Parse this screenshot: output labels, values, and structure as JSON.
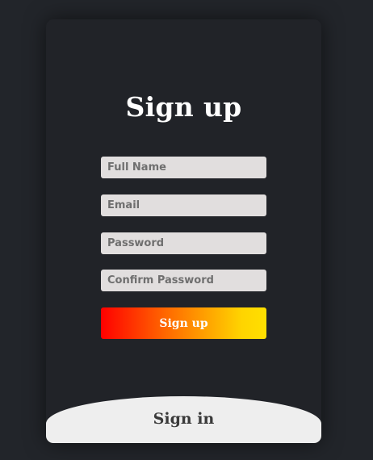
{
  "signup": {
    "title": "Sign up",
    "fields": {
      "full_name": {
        "placeholder": "Full Name",
        "value": ""
      },
      "email": {
        "placeholder": "Email",
        "value": ""
      },
      "password": {
        "placeholder": "Password",
        "value": ""
      },
      "confirm_password": {
        "placeholder": "Confirm Password",
        "value": ""
      }
    },
    "submit_label": "Sign up"
  },
  "signin": {
    "label": "Sign in"
  },
  "colors": {
    "page_background": "#22252a",
    "card_background": "#212328",
    "input_background": "#e1dede",
    "button_gradient_start": "#ff0000",
    "button_gradient_end": "#ffe000",
    "signin_background": "#eeeeee"
  }
}
